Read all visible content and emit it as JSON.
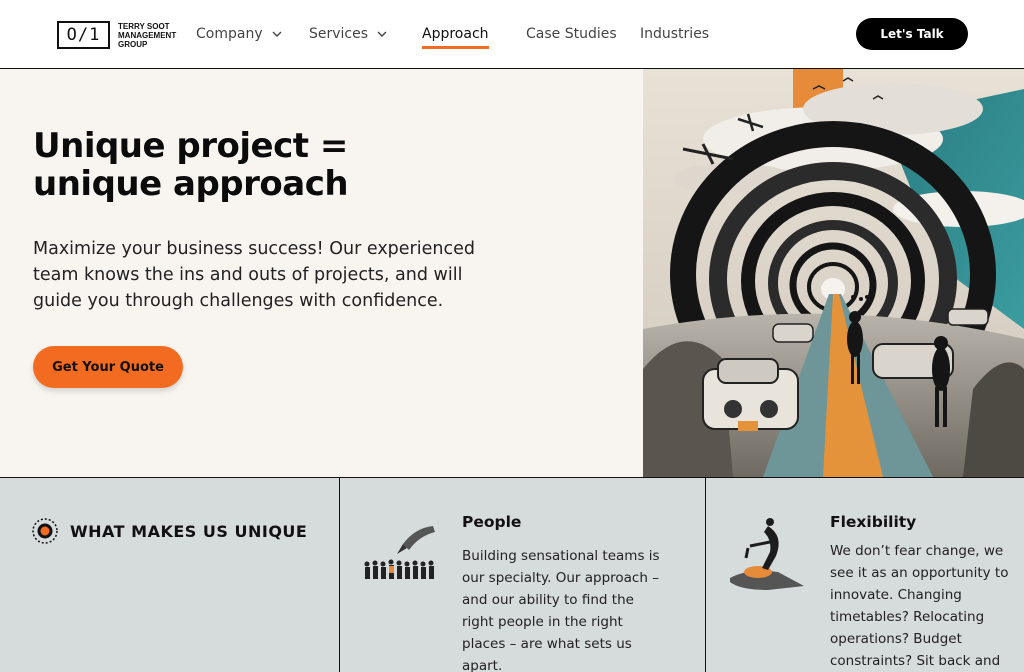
{
  "header": {
    "logo": {
      "mark": "O/1",
      "lines": [
        "TERRY SOOT",
        "MANAGEMENT",
        "GROUP"
      ]
    },
    "nav": [
      {
        "label": "Company",
        "has_dropdown": true,
        "icon": "chevron-down-icon"
      },
      {
        "label": "Services",
        "has_dropdown": true,
        "icon": "chevron-down-icon"
      },
      {
        "label": "Approach",
        "active": true
      },
      {
        "label": "Case Studies"
      },
      {
        "label": "Industries"
      }
    ],
    "cta_label": "Let's Talk"
  },
  "hero": {
    "title_line1": "Unique project =",
    "title_line2": "unique approach",
    "lead": "Maximize your business success! Our experienced team knows the ins and outs of projects, and will guide you through challenges with confidence.",
    "button_label": "Get Your Quote",
    "image_icon": "surreal-collage-road-tunnel"
  },
  "unique": {
    "label": "WHAT MAKES US UNIQUE",
    "label_icon": "target-icon",
    "features": [
      {
        "title": "People",
        "icon": "people-group-illustration",
        "text": "Building sensational teams is our specialty. Our approach – and our ability to find the right people in the right places – are what sets us apart."
      },
      {
        "title": "Flexibility",
        "icon": "hand-figure-illustration",
        "text": "We don’t fear change, we see it as an opportunity to innovate. Changing timetables? Relocating operations? Budget constraints? Sit back and"
      }
    ]
  },
  "colors": {
    "accent": "#f26b21",
    "hero_bg": "#f8f5f0",
    "section_bg": "#d6dbdb",
    "dark": "#000000"
  }
}
